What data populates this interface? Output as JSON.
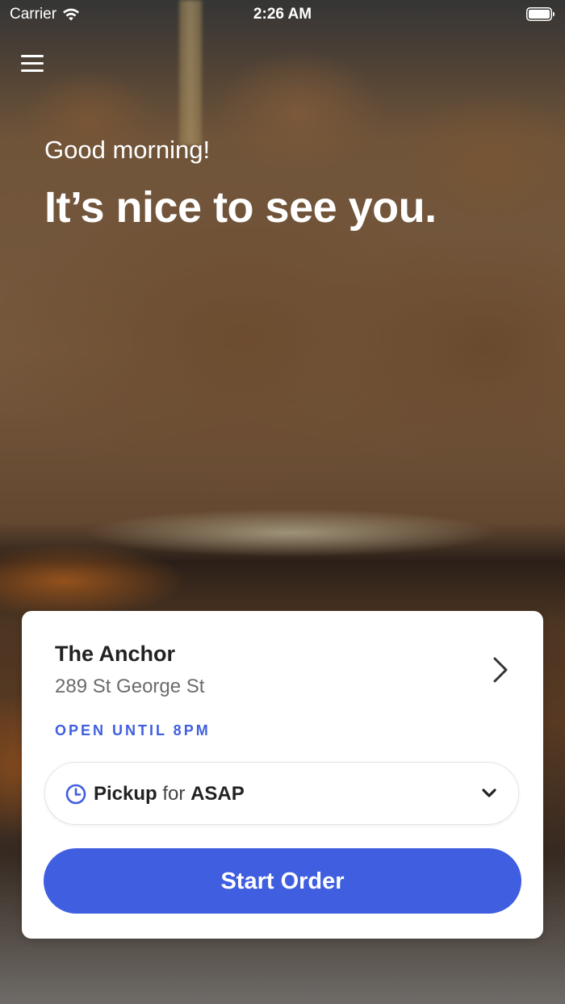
{
  "status_bar": {
    "carrier": "Carrier",
    "time": "2:26 AM"
  },
  "header": {
    "greeting": "Good morning!",
    "headline": "It’s nice to see you."
  },
  "store": {
    "name": "The Anchor",
    "address": "289 St George St",
    "open_status": "OPEN UNTIL 8PM"
  },
  "pickup": {
    "mode": "Pickup",
    "connector": "for",
    "time": "ASAP"
  },
  "actions": {
    "start_order": "Start Order"
  },
  "theme": {
    "accent": "#3f5ee0",
    "card_background": "#ffffff",
    "text_primary": "#222222",
    "text_secondary": "#6b6b6b"
  },
  "icons": [
    "wifi-icon",
    "battery-icon",
    "menu-icon",
    "chevron-right-icon",
    "clock-icon",
    "chevron-down-icon"
  ]
}
